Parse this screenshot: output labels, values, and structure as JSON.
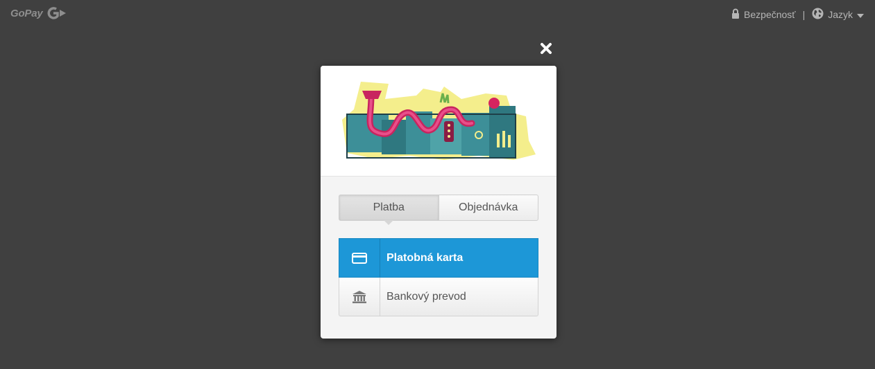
{
  "header": {
    "brand": "GoPay",
    "brand_icon": "gopay-g-icon",
    "security_label": "Bezpečnosť",
    "security_icon": "lock-icon",
    "separator": "|",
    "language_label": "Jazyk",
    "language_icon": "globe-icon",
    "language_caret": "caret-down-icon"
  },
  "modal": {
    "close_icon": "close-icon",
    "logo_icon": "merchant-logo",
    "tabs": [
      {
        "label": "Platba",
        "active": true
      },
      {
        "label": "Objednávka",
        "active": false
      }
    ],
    "methods": [
      {
        "label": "Platobná karta",
        "icon": "credit-card-icon",
        "active": true
      },
      {
        "label": "Bankový prevod",
        "icon": "bank-icon",
        "active": false
      }
    ]
  },
  "colors": {
    "background": "#404040",
    "accent": "#1d97d7",
    "modal_bg": "#f4f4f4"
  }
}
